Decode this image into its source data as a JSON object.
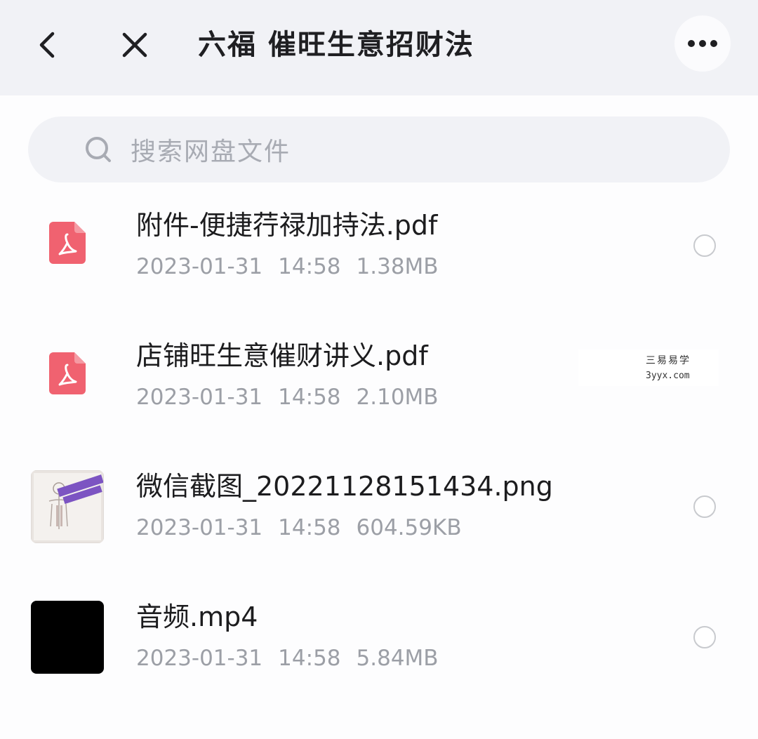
{
  "header": {
    "title": "六福 催旺生意招财法",
    "back_icon": "chevron-left-icon",
    "close_icon": "close-icon",
    "more_icon": "more-horizontal-icon"
  },
  "search": {
    "placeholder": "搜索网盘文件",
    "icon": "search-icon"
  },
  "files": [
    {
      "name": "附件-便捷荇禄加持法.pdf",
      "date": "2023-01-31",
      "time": "14:58",
      "size": "1.38MB",
      "type": "pdf",
      "icon": "pdf-icon"
    },
    {
      "name": "店铺旺生意催财讲义.pdf",
      "date": "2023-01-31",
      "time": "14:58",
      "size": "2.10MB",
      "type": "pdf",
      "icon": "pdf-icon"
    },
    {
      "name": "微信截图_20221128151434.png",
      "date": "2023-01-31",
      "time": "14:58",
      "size": "604.59KB",
      "type": "image",
      "icon": "image-thumbnail"
    },
    {
      "name": "音频.mp4",
      "date": "2023-01-31",
      "time": "14:58",
      "size": "5.84MB",
      "type": "video",
      "icon": "video-thumbnail"
    }
  ],
  "watermark": {
    "line1": "三易易学",
    "line2": "3yyx.com"
  },
  "colors": {
    "header_bg": "#f1f2f6",
    "page_bg": "#fdfdfe",
    "pdf_red": "#f06270",
    "meta_gray": "#9c9fa6",
    "text_dark": "#1c1c1e"
  }
}
